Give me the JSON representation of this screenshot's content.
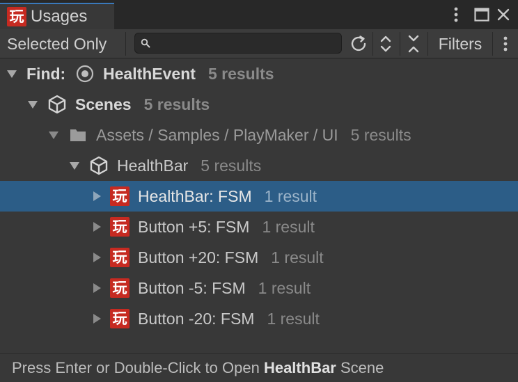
{
  "window": {
    "tab_title": "Usages",
    "tab_icon": "playmaker-icon",
    "icon_glyph": "玩"
  },
  "toolbar": {
    "selected_only_label": "Selected Only",
    "search_value": "",
    "search_placeholder": "",
    "filters_label": "Filters"
  },
  "tree": {
    "root": {
      "prefix": "Find:",
      "name": "HealthEvent",
      "count": "5 results"
    },
    "scene_group": {
      "name": "Scenes",
      "count": "5 results"
    },
    "folder": {
      "path": "Assets / Samples / PlayMaker / UI",
      "count": "5 results"
    },
    "object": {
      "name": "HealthBar",
      "count": "5 results"
    },
    "items": [
      {
        "label": "HealthBar: FSM",
        "count": "1 result",
        "selected": true
      },
      {
        "label": "Button +5: FSM",
        "count": "1 result",
        "selected": false
      },
      {
        "label": "Button +20: FSM",
        "count": "1 result",
        "selected": false
      },
      {
        "label": "Button -5: FSM",
        "count": "1 result",
        "selected": false
      },
      {
        "label": "Button -20: FSM",
        "count": "1 result",
        "selected": false
      }
    ]
  },
  "status": {
    "prefix": "Press Enter or Double-Click to Open",
    "target": "HealthBar",
    "suffix": "Scene"
  },
  "colors": {
    "accent": "#3a79bb",
    "selection": "#2c5d87",
    "playmaker_red": "#c62a21",
    "background": "#383838"
  }
}
